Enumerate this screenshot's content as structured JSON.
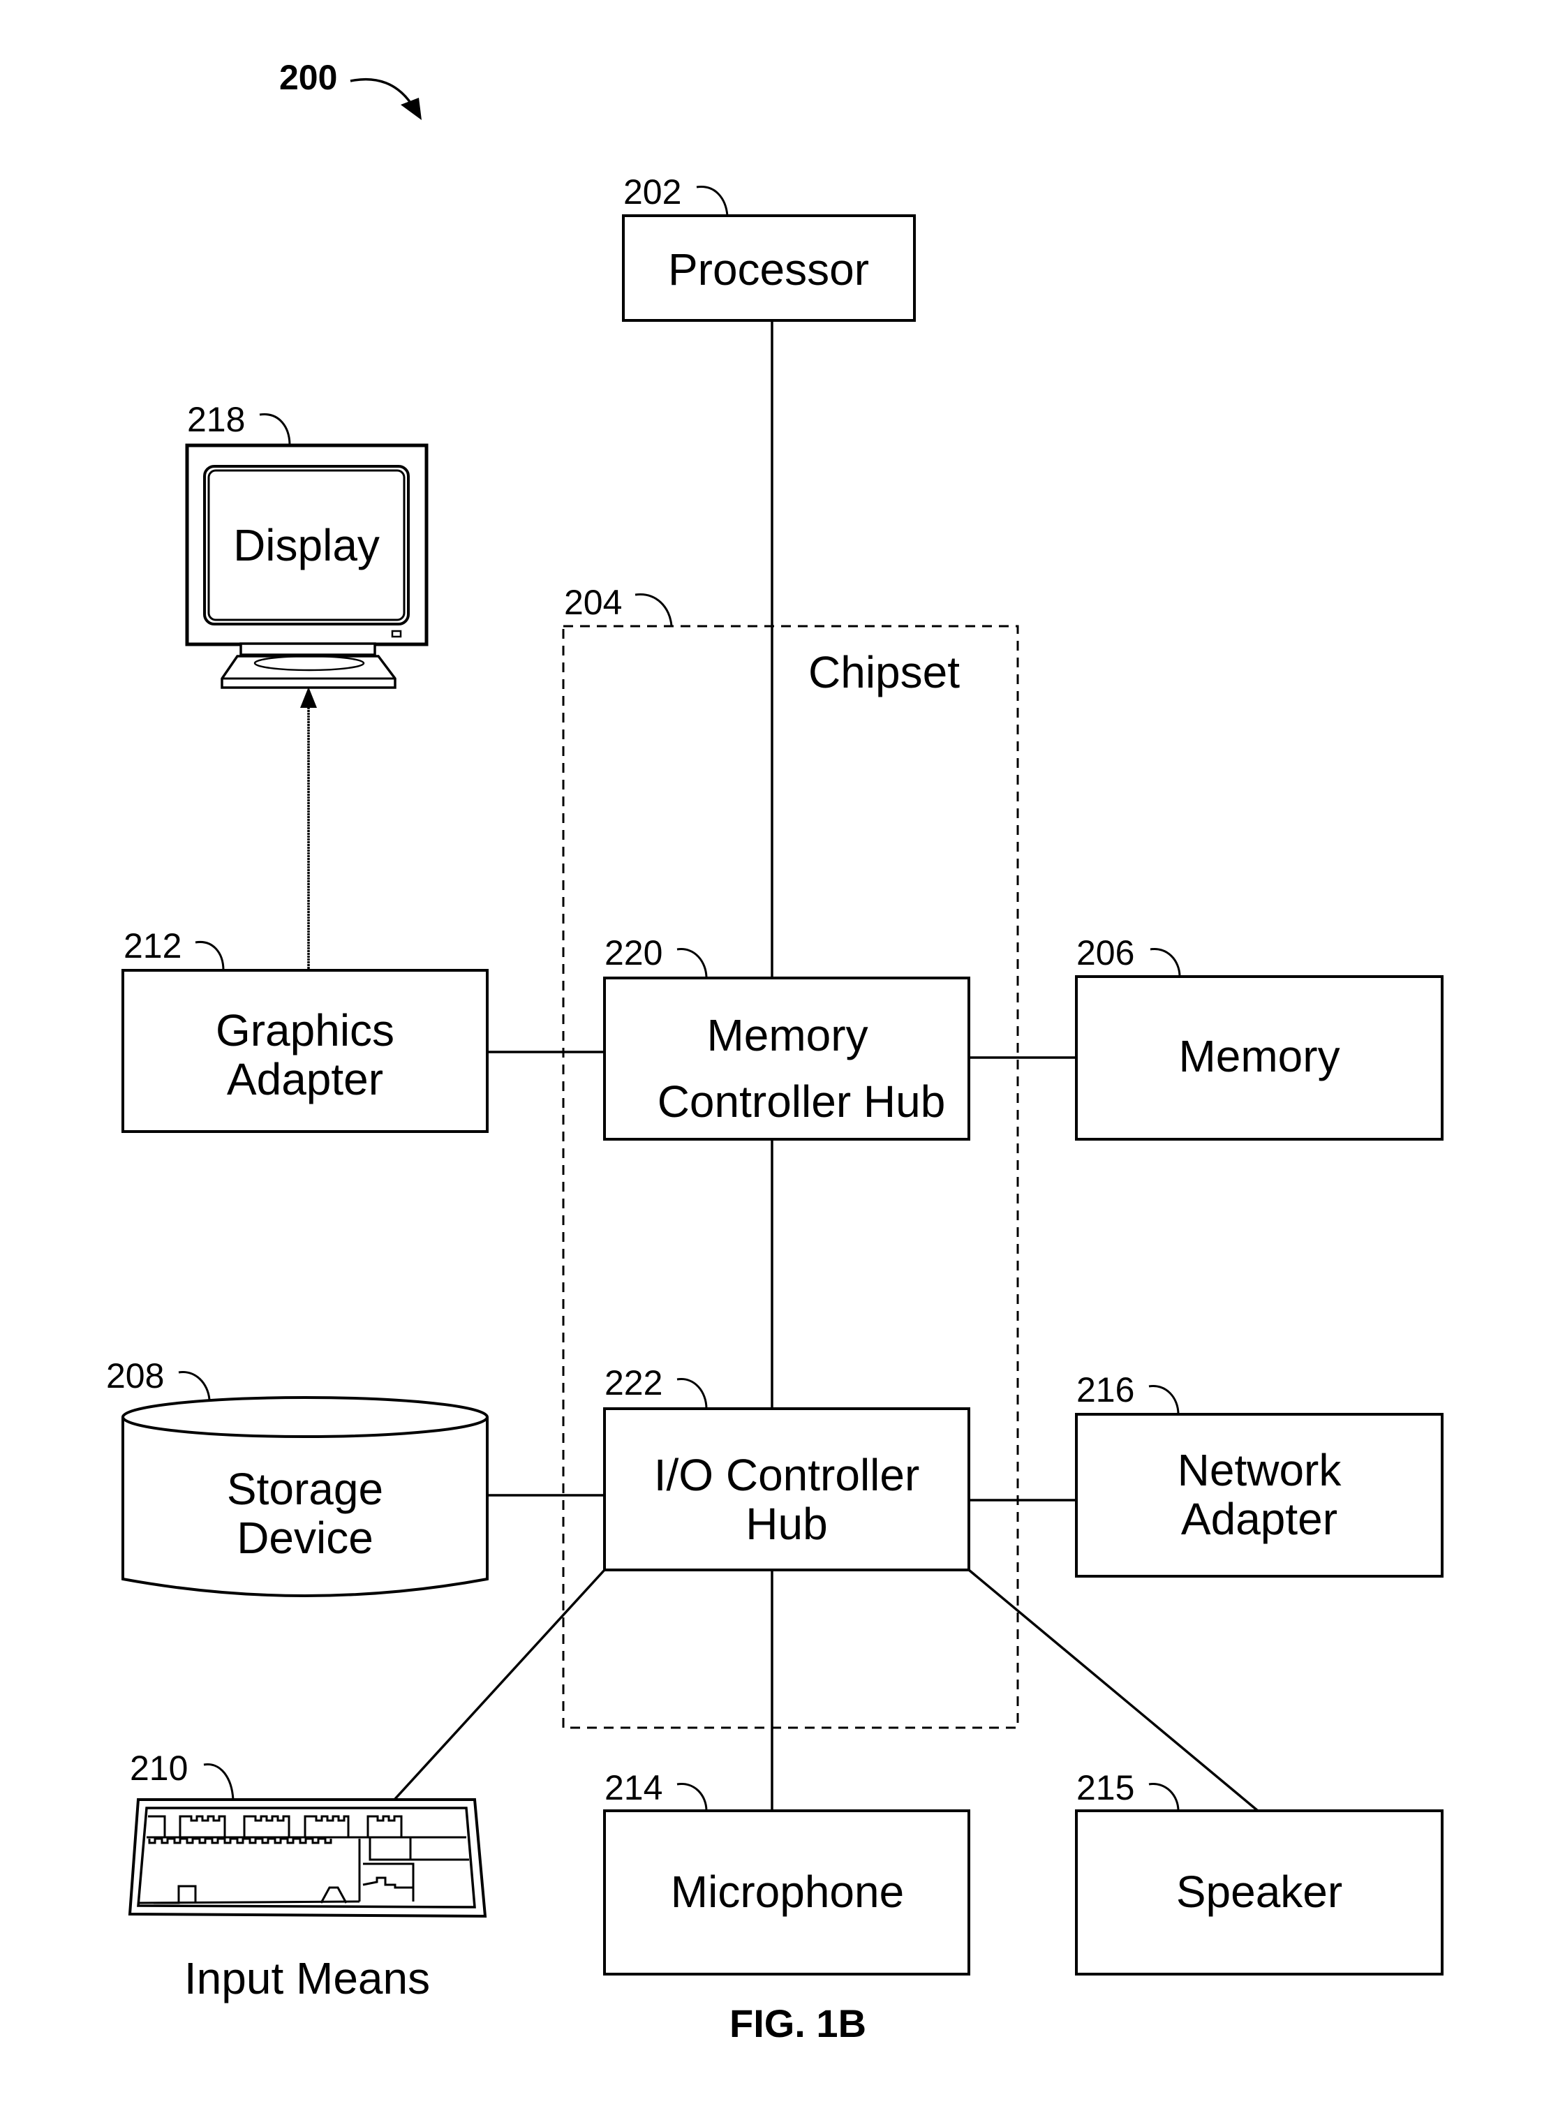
{
  "figure": {
    "number_label": "200",
    "caption": "FIG. 1B"
  },
  "components": {
    "processor": {
      "ref": "202",
      "label": "Processor"
    },
    "chipset": {
      "ref": "204",
      "label": "Chipset"
    },
    "memory": {
      "ref": "206",
      "label": "Memory"
    },
    "storage_device": {
      "ref": "208",
      "label_line1": "Storage",
      "label_line2": "Device"
    },
    "input_means": {
      "ref": "210",
      "label": "Input Means"
    },
    "graphics_adapter": {
      "ref": "212",
      "label_line1": "Graphics",
      "label_line2": "Adapter"
    },
    "microphone": {
      "ref": "214",
      "label": "Microphone"
    },
    "speaker": {
      "ref": "215",
      "label": "Speaker"
    },
    "network_adapter": {
      "ref": "216",
      "label_line1": "Network",
      "label_line2": "Adapter"
    },
    "display": {
      "ref": "218",
      "label": "Display"
    },
    "memory_controller_hub": {
      "ref": "220",
      "label_line1": "Memory",
      "label_line2": "Controller Hub"
    },
    "io_controller_hub": {
      "ref": "222",
      "label_line1": "I/O Controller",
      "label_line2": "Hub"
    }
  }
}
